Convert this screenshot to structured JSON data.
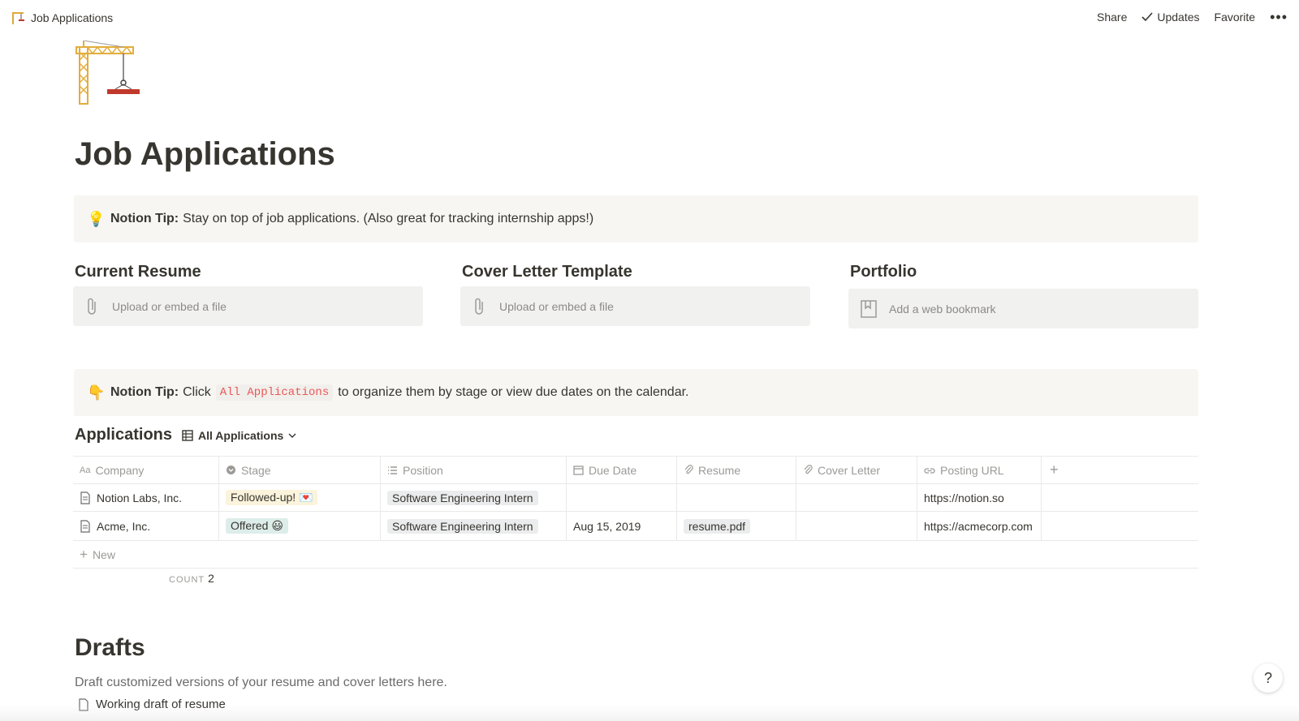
{
  "topbar": {
    "title": "Job Applications",
    "share_label": "Share",
    "updates_label": "Updates",
    "favorite_label": "Favorite",
    "more_label": "•••"
  },
  "page": {
    "title": "Job Applications",
    "icon": "construction-crane-icon"
  },
  "tip1": {
    "label": "Notion Tip:",
    "text": "Stay on top of job applications. (Also great for tracking internship apps!)"
  },
  "columns": [
    {
      "title": "Current Resume",
      "placeholder": "Upload or embed a file"
    },
    {
      "title": "Cover Letter Template",
      "placeholder": "Upload or embed a file"
    },
    {
      "title": "Portfolio",
      "placeholder": "Add a web bookmark"
    }
  ],
  "tip2": {
    "label": "Notion Tip:",
    "pre": "Click",
    "code": "All Applications",
    "post": "to organize them by stage or view due dates on the calendar."
  },
  "database": {
    "title": "Applications",
    "view": "All Applications",
    "headers": [
      "Company",
      "Stage",
      "Position",
      "Due Date",
      "Resume",
      "Cover Letter",
      "Posting URL"
    ],
    "rows": [
      {
        "company": "Notion Labs, Inc.",
        "stage": "Followed-up! 💌",
        "position": "Software Engineering Intern",
        "due": "",
        "resume": "",
        "cover": "",
        "url": "https://notion.so"
      },
      {
        "company": "Acme, Inc.",
        "stage": "Offered 😃",
        "position": "Software Engineering Intern",
        "due": "Aug 15, 2019",
        "resume": "resume.pdf",
        "cover": "",
        "url": "https://acmecorp.com"
      }
    ],
    "new_label": "New",
    "count_label": "COUNT",
    "count_value": "2"
  },
  "drafts": {
    "title": "Drafts",
    "description": "Draft customized versions of your resume and cover letters here.",
    "item": "Working draft of resume"
  },
  "help_label": "?",
  "colors": {
    "text": "#37352f",
    "callout_bg": "#f7f6f3",
    "code_red": "#eb5757",
    "tag_yellow": "#fbf3db",
    "tag_green": "#ddedea"
  }
}
